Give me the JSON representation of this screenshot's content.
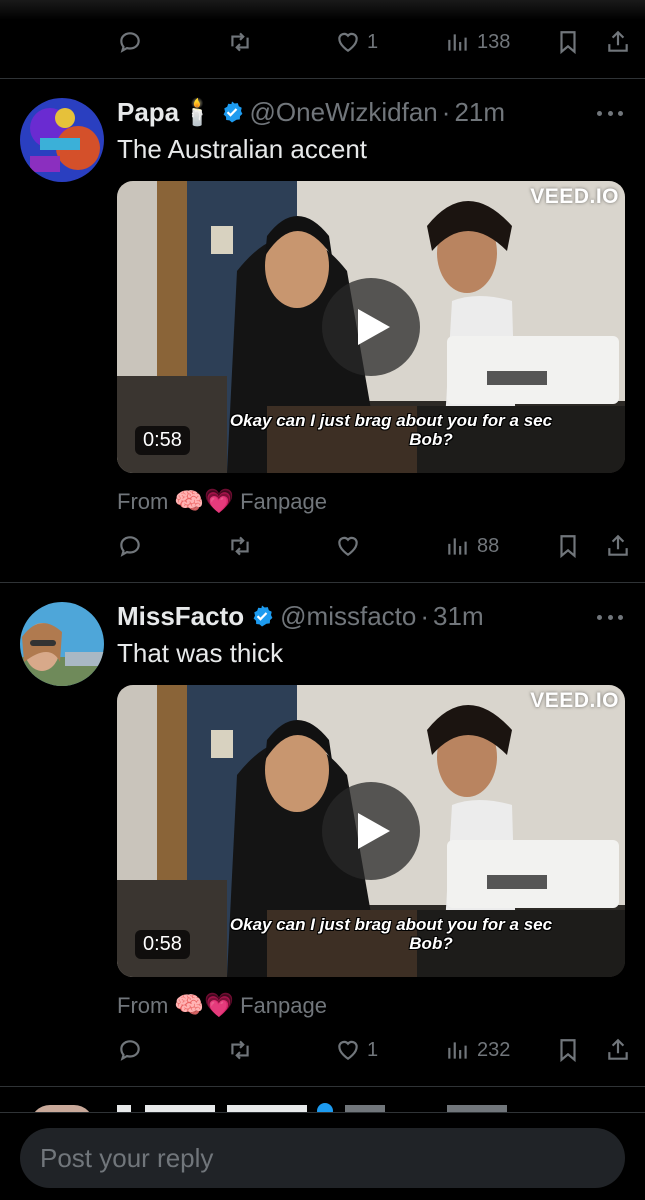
{
  "top_actions": {
    "likes": "1",
    "views": "138"
  },
  "tweets": [
    {
      "name": "Papa",
      "name_emoji": "🕯️",
      "handle": "@OneWizkidfan",
      "separator": "·",
      "time": "21m",
      "text": "The Australian accent",
      "video": {
        "duration": "0:58",
        "watermark": "VEED.IO",
        "caption_line1": "Okay can I just brag about you for a sec",
        "caption_line2": "Bob?"
      },
      "from_label": "From",
      "from_emojis": "🧠💗",
      "from_source": "Fanpage",
      "likes": "",
      "views": "88"
    },
    {
      "name": "MissFacto",
      "name_emoji": "",
      "handle": "@missfacto",
      "separator": "·",
      "time": "31m",
      "text": "That was thick",
      "video": {
        "duration": "0:58",
        "watermark": "VEED.IO",
        "caption_line1": "Okay can I just brag about you for a sec",
        "caption_line2": "Bob?"
      },
      "from_label": "From",
      "from_emojis": "🧠💗",
      "from_source": "Fanpage",
      "likes": "1",
      "views": "232"
    }
  ],
  "reply": {
    "placeholder": "Post your reply"
  },
  "colors": {
    "background": "#000000",
    "text": "#e7e9ea",
    "muted": "#71767b",
    "verified": "#1d9bf0",
    "divider": "#2f3336"
  }
}
